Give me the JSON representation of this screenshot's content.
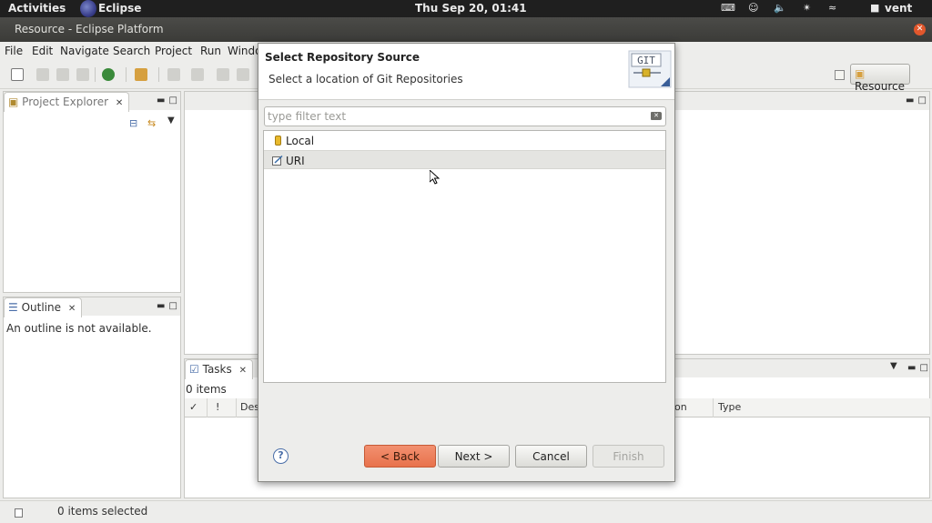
{
  "topbar": {
    "activities": "Activities",
    "app_name": "Eclipse",
    "clock": "Thu Sep 20, 01:41",
    "user": "vent"
  },
  "window": {
    "title": "Resource - Eclipse Platform"
  },
  "menu": {
    "items": [
      "File",
      "Edit",
      "Navigate",
      "Search",
      "Project",
      "Run",
      "Windo"
    ]
  },
  "perspective": {
    "label": "Resource"
  },
  "project_explorer": {
    "title": "Project Explorer"
  },
  "outline": {
    "title": "Outline",
    "message": "An outline is not available."
  },
  "tasks": {
    "title": "Tasks",
    "count": "0 items",
    "columns": [
      "✓",
      "!",
      "Des",
      "on",
      "Type"
    ]
  },
  "status": {
    "text": "0 items selected"
  },
  "dialog": {
    "title": "Select Repository Source",
    "subtitle": "Select a location of Git Repositories",
    "logo_text": "GIT",
    "filter_placeholder": "type filter text",
    "items": [
      {
        "label": "Local",
        "icon": "local-repo-icon",
        "selected": false
      },
      {
        "label": "URI",
        "icon": "uri-icon",
        "selected": true
      }
    ],
    "buttons": {
      "back": "< Back",
      "next": "Next >",
      "cancel": "Cancel",
      "finish": "Finish"
    },
    "help": "?"
  },
  "colors": {
    "primary_button": "#e8724c",
    "topbar": "#1f1f1f",
    "titlebar": "#3b3b38"
  }
}
